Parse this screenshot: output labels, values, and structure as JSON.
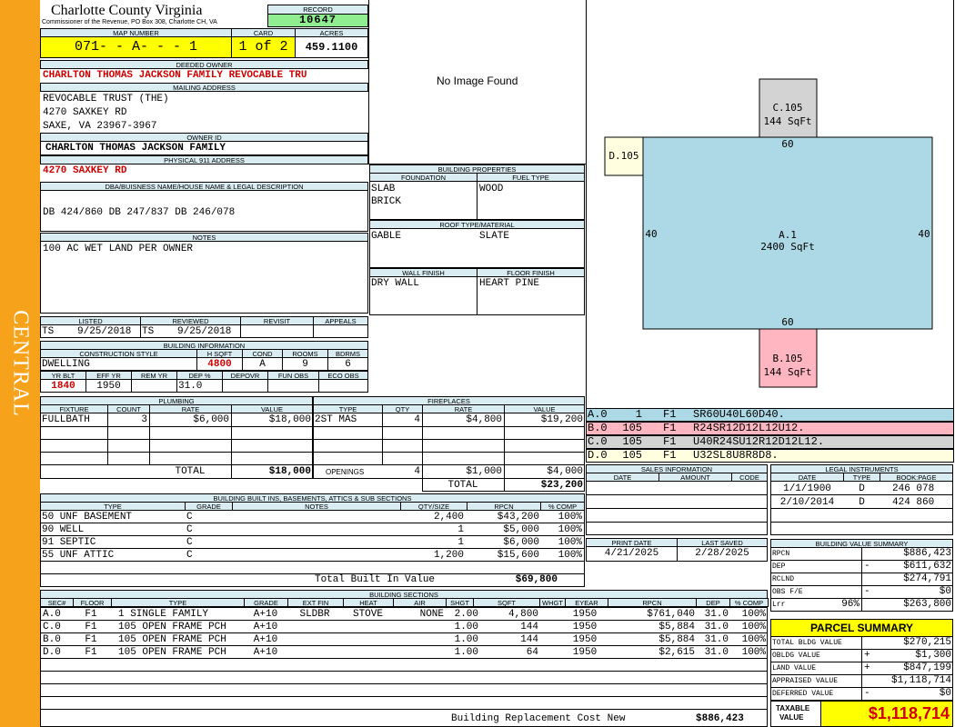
{
  "side_label": "CENTRAL",
  "header": {
    "county": "Charlotte County Virginia",
    "commissioner": "Commissioner of the Revenue, PO Box 308, Charlotte CH, VA",
    "record_label": "RECORD",
    "record": "10647",
    "map_number_label": "MAP NUMBER",
    "map_number": "071- - A- - - 1",
    "card_label": "CARD",
    "card": "1 of 2",
    "acres_label": "ACRES",
    "acres": "459.1100"
  },
  "owner": {
    "deeded_owner_label": "DEEDED OWNER",
    "deeded_owner": "CHARLTON THOMAS JACKSON FAMILY REVOCABLE TRU",
    "mailing_label": "MAILING ADDRESS",
    "mailing": [
      "REVOCABLE TRUST (THE)",
      "4270 SAXKEY RD",
      "SAXE, VA 23967-3967"
    ],
    "owner_id_label": "OWNER ID",
    "owner_id": "CHARLTON THOMAS JACKSON FAMILY",
    "physical_label": "PHYSICAL 911 ADDRESS",
    "physical": "4270 SAXKEY RD",
    "dba_label": "DBA/BUISNESS NAME/HOUSE NAME & LEGAL DESCRIPTION",
    "dba": "DB 424/860 DB 247/837 DB 246/078",
    "notes_label": "NOTES",
    "notes": "100 AC WET LAND PER OWNER"
  },
  "image_text": "No Image Found",
  "building_properties": {
    "title": "BUILDING PROPERTIES",
    "foundation_label": "FOUNDATION",
    "fuel_label": "FUEL TYPE",
    "foundation": [
      "SLAB",
      "BRICK"
    ],
    "fuel": "WOOD",
    "roof_label": "ROOF TYPE/MATERIAL",
    "roof_type": "GABLE",
    "roof_material": "SLATE",
    "wall_label": "WALL FINISH",
    "floor_label": "FLOOR FINISH",
    "wall": "DRY WALL",
    "floor": "HEART PINE"
  },
  "status": {
    "listed_label": "LISTED",
    "reviewed_label": "REVIEWED",
    "revisit_label": "REVISIT",
    "appeals_label": "APPEALS",
    "listed_by": "TS",
    "listed_date": "9/25/2018",
    "reviewed_by": "TS",
    "reviewed_date": "9/25/2018"
  },
  "building_info": {
    "title": "BUILDING INFORMATION",
    "construction_label": "CONSTRUCTION STYLE",
    "hsqft_label": "H SQFT",
    "cond_label": "COND",
    "rooms_label": "ROOMS",
    "bdrms_label": "BDRMS",
    "construction": "DWELLING",
    "hsqft": "4800",
    "cond": "A",
    "rooms": "9",
    "bdrms": "6",
    "yrblt_label": "YR BLT",
    "effyr_label": "EFF YR",
    "remyr_label": "REM YR",
    "dep_label": "DEP %",
    "depovr_label": "DEPOVR",
    "funobs_label": "FUN OBS",
    "ecoobs_label": "ECO OBS",
    "yrblt": "1840",
    "effyr": "1950",
    "dep": "31.0"
  },
  "plumbing": {
    "title": "PLUMBING",
    "headers": [
      "FIXTURE",
      "COUNT",
      "RATE",
      "VALUE"
    ],
    "rows": [
      [
        "FULLBATH",
        "3",
        "$6,000",
        "$18,000"
      ]
    ],
    "total_label": "TOTAL",
    "total": "$18,000"
  },
  "fireplaces": {
    "title": "FIREPLACES",
    "headers": [
      "TYPE",
      "QTY",
      "RATE",
      "VALUE"
    ],
    "rows": [
      [
        "2ST MAS",
        "4",
        "$4,800",
        "$19,200"
      ]
    ],
    "openings_label": "OPENINGS",
    "openings_qty": "4",
    "openings_rate": "$1,000",
    "openings_value": "$4,000",
    "total_label": "TOTAL",
    "total": "$23,200"
  },
  "sketch": {
    "labels": {
      "c": [
        "C.105",
        "144 SqFt"
      ],
      "d": "D.105",
      "a": [
        "A.1",
        "2400 SqFt"
      ],
      "b": [
        "B.105",
        "144 SqFt"
      ]
    },
    "dims": {
      "top": "60",
      "bottom": "60",
      "left": "40",
      "right": "40"
    },
    "colors": {
      "main": "#add8e6",
      "c_area": "#d3d3d3",
      "b_area": "#ffb6c1",
      "d_area": "#ffffe0"
    },
    "legend": [
      {
        "code": "A.0",
        "num": "1",
        "floor": "F1",
        "path": "SR60U40L60D40.",
        "color": "#add8e6"
      },
      {
        "code": "B.0",
        "num": "105",
        "floor": "F1",
        "path": "R24SR12D12L12U12.",
        "color": "#ffb6c1"
      },
      {
        "code": "C.0",
        "num": "105",
        "floor": "F1",
        "path": "U40R24SU12R12D12L12.",
        "color": "#d3d3d3"
      },
      {
        "code": "D.0",
        "num": "105",
        "floor": "F1",
        "path": "U32SL8U8R8D8.",
        "color": "#ffffe0"
      }
    ]
  },
  "sales": {
    "title": "SALES INFORMATION",
    "headers": [
      "DATE",
      "AMOUNT",
      "CODE"
    ]
  },
  "legal": {
    "title": "LEGAL INSTRUMENTS",
    "headers": [
      "DATE",
      "TYPE",
      "BOOK:PAGE"
    ],
    "rows": [
      [
        "1/1/1900",
        "D",
        "246 078"
      ],
      [
        "2/10/2014",
        "D",
        "424 860"
      ]
    ]
  },
  "dates": {
    "print_label": "PRINT DATE",
    "print": "4/21/2025",
    "saved_label": "LAST SAVED",
    "saved": "2/28/2025"
  },
  "built_ins": {
    "title": "BUILDING BUILT INS, BASEMENTS, ATTICS & SUB SECTIONS",
    "headers": [
      "TYPE",
      "GRADE",
      "NOTES",
      "QTY/SIZE",
      "RPCN",
      "% COMP"
    ],
    "rows": [
      [
        "50 UNF BASEMENT",
        "C",
        "",
        "2,400",
        "$43,200",
        "100%"
      ],
      [
        "90 WELL",
        "C",
        "",
        "1",
        "$5,000",
        "100%"
      ],
      [
        "91 SEPTIC",
        "C",
        "",
        "1",
        "$6,000",
        "100%"
      ],
      [
        "55 UNF ATTIC",
        "C",
        "",
        "1,200",
        "$15,600",
        "100%"
      ]
    ],
    "total_label": "Total Built In Value",
    "total": "$69,800"
  },
  "sections": {
    "title": "BUILDING SECTIONS",
    "headers": [
      "SEC#",
      "FLOOR",
      "TYPE",
      "GRADE",
      "EXT FIN",
      "HEAT",
      "AIR",
      "SHGT",
      "SQFT",
      "WHGT",
      "EYEAR",
      "RPCN",
      "DEP",
      "% COMP"
    ],
    "rows": [
      [
        "A.0",
        "F1",
        "1 SINGLE FAMILY",
        "A+10",
        "SLDBR",
        "STOVE",
        "NONE",
        "2.00",
        "4,800",
        "",
        "1950",
        "$761,040",
        "31.0",
        "100%"
      ],
      [
        "C.0",
        "F1",
        "105 OPEN FRAME PCH",
        "A+10",
        "",
        "",
        "",
        "1.00",
        "144",
        "",
        "1950",
        "$5,884",
        "31.0",
        "100%"
      ],
      [
        "B.0",
        "F1",
        "105 OPEN FRAME PCH",
        "A+10",
        "",
        "",
        "",
        "1.00",
        "144",
        "",
        "1950",
        "$5,884",
        "31.0",
        "100%"
      ],
      [
        "D.0",
        "F1",
        "105 OPEN FRAME PCH",
        "A+10",
        "",
        "",
        "",
        "1.00",
        "64",
        "",
        "1950",
        "$2,615",
        "31.0",
        "100%"
      ]
    ],
    "replacement_label": "Building Replacement Cost New",
    "replacement": "$886,423"
  },
  "value_summary": {
    "title": "BUILDING VALUE SUMMARY",
    "rows": [
      {
        "label": "RPCN",
        "sign": "",
        "pct": "",
        "value": "$886,423"
      },
      {
        "label": "DEP",
        "sign": "-",
        "pct": "",
        "value": "$611,632"
      },
      {
        "label": "RCLND",
        "sign": "",
        "pct": "",
        "value": "$274,791"
      },
      {
        "label": "OBS F/E",
        "sign": "-",
        "pct": "",
        "value": "$0"
      },
      {
        "label": "Lrr",
        "sign": "",
        "pct": "96%",
        "value": "$263,800"
      }
    ]
  },
  "parcel_summary": {
    "title": "PARCEL SUMMARY",
    "rows": [
      {
        "label": "TOTAL BLDG VALUE",
        "sign": "",
        "value": "$270,215"
      },
      {
        "label": "OBLDG VALUE",
        "sign": "+",
        "value": "$1,300"
      },
      {
        "label": "LAND VALUE",
        "sign": "+",
        "value": "$847,199"
      },
      {
        "label": "APPRAISED VALUE",
        "sign": "",
        "value": "$1,118,714"
      },
      {
        "label": "DEFERRED VALUE",
        "sign": "-",
        "value": "$0"
      }
    ],
    "taxable_label": [
      "TAXABLE",
      "VALUE"
    ],
    "taxable": "$1,118,714"
  }
}
